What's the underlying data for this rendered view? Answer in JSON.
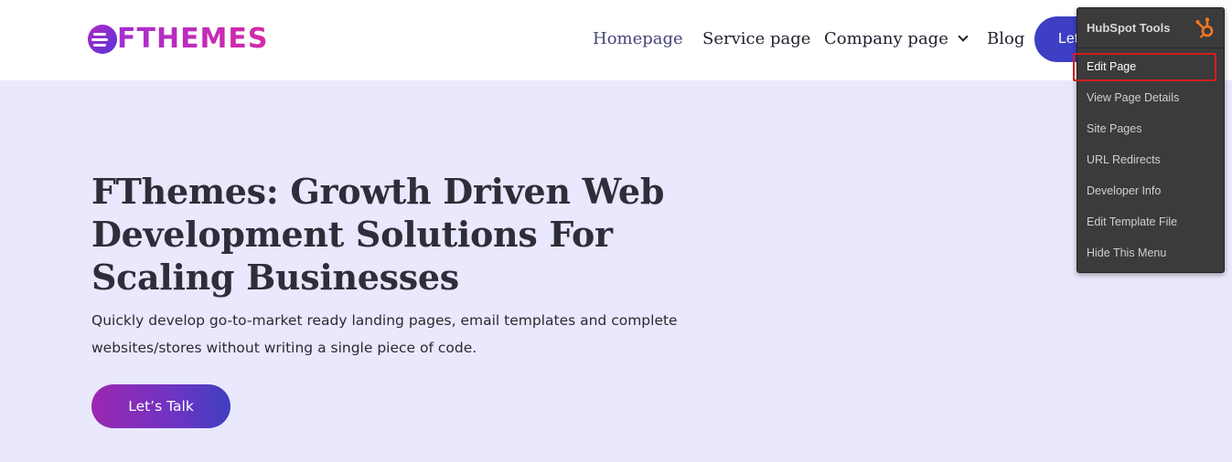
{
  "header": {
    "logo_text": "FTHEMES",
    "nav": [
      {
        "label": "Homepage"
      },
      {
        "label": "Service page"
      },
      {
        "label": "Company page"
      },
      {
        "label": "Blog"
      }
    ],
    "cta_label": "Let's Talk"
  },
  "hero": {
    "title": "FThemes: Growth Driven Web Development Solutions For Scaling Businesses",
    "subtitle": "Quickly develop go-to-market ready landing pages, email templates and complete websites/stores without writing a single piece of code.",
    "cta_label": "Let’s Talk"
  },
  "hubspot_menu": {
    "title": "HubSpot Tools",
    "items": [
      {
        "label": "Edit Page"
      },
      {
        "label": "View Page Details"
      },
      {
        "label": "Site Pages"
      },
      {
        "label": "URL Redirects"
      },
      {
        "label": "Developer Info"
      },
      {
        "label": "Edit Template File"
      },
      {
        "label": "Hide This Menu"
      }
    ],
    "highlighted_item": "Edit Page"
  },
  "colors": {
    "page_background": "#e9e8fc",
    "accent_blue": "#3d3fc4",
    "brand_magenta": "#b128c4",
    "hubspot_orange": "#f57722",
    "highlight_red": "#d11f1f"
  },
  "icons": [
    "logo-mark-icon",
    "chevron-down-icon",
    "hubspot-sprocket-icon"
  ]
}
